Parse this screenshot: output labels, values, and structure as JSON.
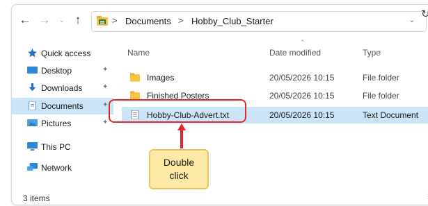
{
  "address_bar": {
    "back_icon": "arrow-left-icon",
    "forward_icon": "arrow-right-icon",
    "recent_icon": "chevron-down-icon",
    "up_icon": "arrow-up-icon",
    "crumbs": [
      "Documents",
      "Hobby_Club_Starter"
    ],
    "separator": ">",
    "dropdown_glyph": "⌄",
    "refresh_glyph": "↻"
  },
  "sidebar": {
    "items": [
      {
        "label": "Quick access",
        "icon": "star-icon",
        "pinned": false
      },
      {
        "label": "Desktop",
        "icon": "desktop-icon",
        "pinned": true
      },
      {
        "label": "Downloads",
        "icon": "download-icon",
        "pinned": true
      },
      {
        "label": "Documents",
        "icon": "documents-icon",
        "pinned": true,
        "selected": true
      },
      {
        "label": "Pictures",
        "icon": "pictures-icon",
        "pinned": true
      },
      {
        "label": "This PC",
        "icon": "computer-icon",
        "pinned": false
      },
      {
        "label": "Network",
        "icon": "network-icon",
        "pinned": false
      }
    ],
    "pin_glyph": "📌"
  },
  "file_list": {
    "columns": [
      "Name",
      "Date modified",
      "Type"
    ],
    "rows": [
      {
        "name": "Images",
        "date": "20/05/2026 10:15",
        "type": "File folder",
        "icon": "folder-icon"
      },
      {
        "name": "Finished Posters",
        "date": "20/05/2026 10:15",
        "type": "File folder",
        "icon": "folder-icon"
      },
      {
        "name": "Hobby-Club-Advert.txt",
        "date": "20/05/2026 10:15",
        "type": "Text Document",
        "icon": "text-file-icon",
        "selected": true
      }
    ]
  },
  "status_bar": {
    "item_count": "3 items"
  },
  "annotation": {
    "line1": "Double",
    "line2": "click"
  },
  "colors": {
    "selection": "#cce4f7",
    "highlight_ring": "#e3262b",
    "callout_fill": "#fde9a6",
    "folder": "#f5c542",
    "accent_blue": "#1e73c8"
  }
}
